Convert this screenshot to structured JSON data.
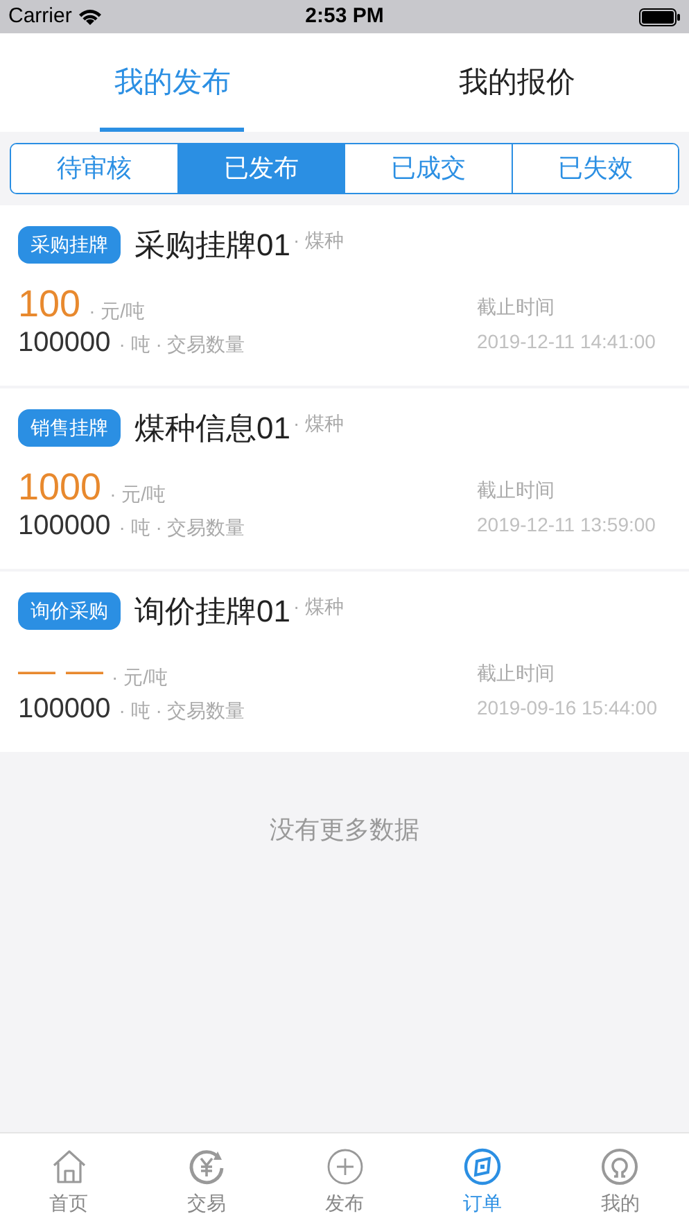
{
  "status_bar": {
    "carrier": "Carrier",
    "time": "2:53 PM"
  },
  "top_tabs": [
    {
      "label": "我的发布",
      "selected": true
    },
    {
      "label": "我的报价",
      "selected": false
    }
  ],
  "segments": [
    {
      "label": "待审核",
      "selected": false
    },
    {
      "label": "已发布",
      "selected": true
    },
    {
      "label": "已成交",
      "selected": false
    },
    {
      "label": "已失效",
      "selected": false
    }
  ],
  "listings": [
    {
      "badge": "采购挂牌",
      "title": "采购挂牌01",
      "category": "· 煤种",
      "price": "100",
      "price_unit": "· 元/吨",
      "quantity": "100000",
      "quantity_unit": "· 吨 · 交易数量",
      "deadline_label": "截止时间",
      "deadline": "2019-12-11 14:41:00"
    },
    {
      "badge": "销售挂牌",
      "title": "煤种信息01",
      "category": "· 煤种",
      "price": "1000",
      "price_unit": "· 元/吨",
      "quantity": "100000",
      "quantity_unit": "· 吨 · 交易数量",
      "deadline_label": "截止时间",
      "deadline": "2019-12-11 13:59:00"
    },
    {
      "badge": "询价采购",
      "title": "询价挂牌01",
      "category": "· 煤种",
      "price": "— —",
      "price_unit": "· 元/吨",
      "quantity": "100000",
      "quantity_unit": "· 吨 · 交易数量",
      "deadline_label": "截止时间",
      "deadline": "2019-09-16 15:44:00"
    }
  ],
  "footer_note": "没有更多数据",
  "tab_bar": [
    {
      "kind": "home",
      "label": "首页",
      "selected": false
    },
    {
      "kind": "trade",
      "label": "交易",
      "selected": false
    },
    {
      "kind": "publish",
      "label": "发布",
      "selected": false
    },
    {
      "kind": "orders",
      "label": "订单",
      "selected": true
    },
    {
      "kind": "profile",
      "label": "我的",
      "selected": false
    }
  ]
}
